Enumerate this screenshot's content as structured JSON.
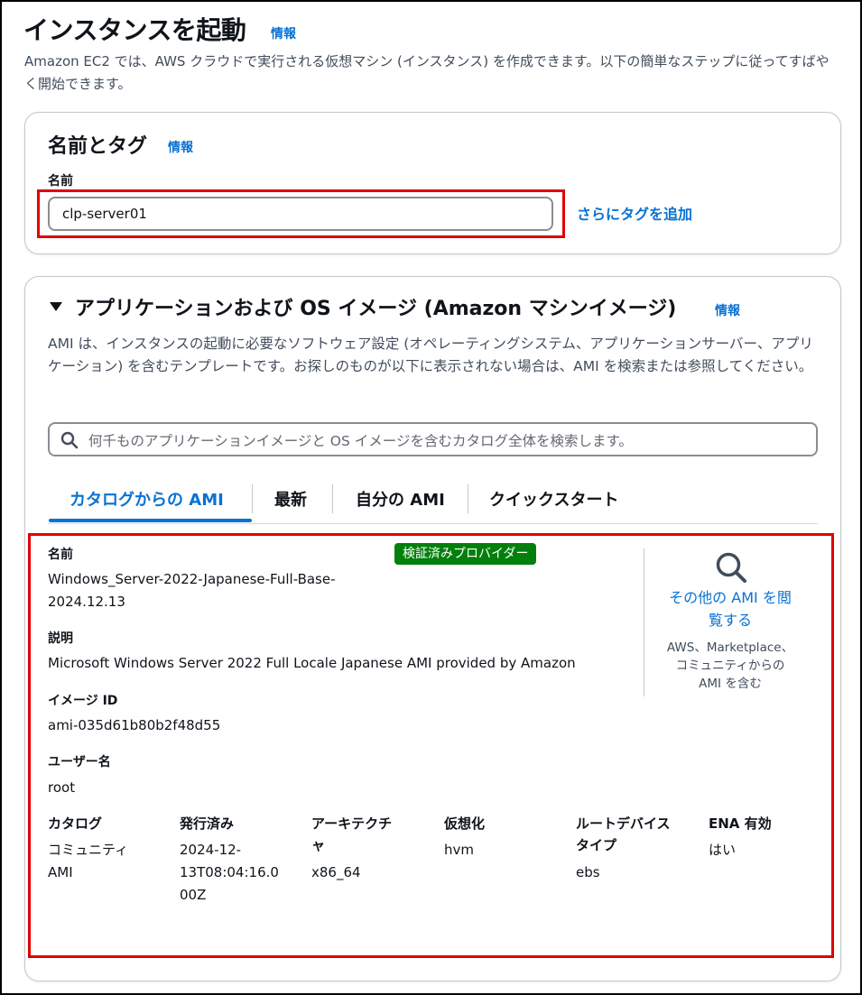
{
  "page": {
    "title": "インスタンスを起動",
    "info": "情報",
    "description": "Amazon EC2 では、AWS クラウドで実行される仮想マシン (インスタンス) を作成できます。以下の簡単なステップに従ってすばやく開始できます。"
  },
  "name_tags": {
    "heading": "名前とタグ",
    "info": "情報",
    "name_label": "名前",
    "name_value": "clp-server01",
    "add_tags": "さらにタグを追加"
  },
  "ami": {
    "heading": "アプリケーションおよび OS イメージ (Amazon マシンイメージ)",
    "info": "情報",
    "description": "AMI は、インスタンスの起動に必要なソフトウェア設定 (オペレーティングシステム、アプリケーションサーバー、アプリケーション) を含むテンプレートです。お探しのものが以下に表示されない場合は、AMI を検索または参照してください。",
    "search_placeholder": "何千ものアプリケーションイメージと OS イメージを含むカタログ全体を検索します。",
    "tabs": [
      "カタログからの AMI",
      "最新",
      "自分の AMI",
      "クイックスタート"
    ],
    "details": {
      "name_label": "名前",
      "name_value_1": "Windows_Server-2022-Japanese-Full-Base-",
      "name_value_2": "2024.12.13",
      "badge": "検証済みプロバイダー",
      "desc_label": "説明",
      "desc_value": "Microsoft Windows Server 2022 Full Locale Japanese AMI provided by Amazon",
      "image_id_label": "イメージ ID",
      "image_id_value": "ami-035d61b80b2f48d55",
      "username_label": "ユーザー名",
      "username_value": "root",
      "browse_link_1": "その他の AMI を閲",
      "browse_link_2": "覧する",
      "browse_note_1": "AWS、Marketplace、",
      "browse_note_2": "コミュニティからの",
      "browse_note_3": "AMI を含む",
      "columns": [
        {
          "label_1": "カタログ",
          "label_2": "",
          "value_1": "コミュニティ",
          "value_2": "AMI",
          "value_3": ""
        },
        {
          "label_1": "発行済み",
          "label_2": "",
          "value_1": "2024-12-",
          "value_2": "13T08:04:16.0",
          "value_3": "00Z"
        },
        {
          "label_1": "アーキテクチ",
          "label_2": "ャ",
          "value_1": "",
          "value_2": "x86_64",
          "value_3": ""
        },
        {
          "label_1": "仮想化",
          "label_2": "",
          "value_1": "hvm",
          "value_2": "",
          "value_3": ""
        },
        {
          "label_1": "ルートデバイス",
          "label_2": "タイプ",
          "value_1": "",
          "value_2": "ebs",
          "value_3": ""
        },
        {
          "label_1": "ENA 有効",
          "label_2": "",
          "value_1": "はい",
          "value_2": "",
          "value_3": ""
        }
      ]
    }
  },
  "colors": {
    "link": "#0972d3",
    "badge": "#037f0c",
    "highlight": "#e00000"
  },
  "icons": [
    "collapse-triangle-icon",
    "search-icon",
    "magnifier-icon"
  ]
}
